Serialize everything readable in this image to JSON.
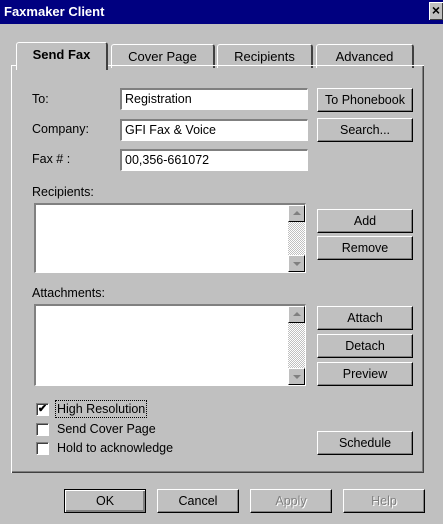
{
  "window": {
    "title": "Faxmaker Client",
    "close_glyph": "×"
  },
  "tabs": [
    {
      "label": "Send Fax"
    },
    {
      "label": "Cover Page"
    },
    {
      "label": "Recipients"
    },
    {
      "label": "Advanced"
    }
  ],
  "form": {
    "to_label": "To:",
    "to_value": "Registration",
    "company_label": "Company:",
    "company_value": "GFI Fax & Voice",
    "fax_label": "Fax # :",
    "fax_value": "00,356-661072"
  },
  "buttons": {
    "to_phonebook": "To Phonebook",
    "search": "Search...",
    "add": "Add",
    "remove": "Remove",
    "attach": "Attach",
    "detach": "Detach",
    "preview": "Preview",
    "schedule": "Schedule",
    "ok": "OK",
    "cancel": "Cancel",
    "apply": "Apply",
    "help": "Help"
  },
  "recipients_label": "Recipients:",
  "attachments_label": "Attachments:",
  "options": [
    {
      "label": "High Resolution",
      "checked": true,
      "mark": "✔"
    },
    {
      "label": "Send Cover Page",
      "checked": false,
      "mark": ""
    },
    {
      "label": "Hold to acknowledge",
      "checked": false,
      "mark": ""
    }
  ]
}
